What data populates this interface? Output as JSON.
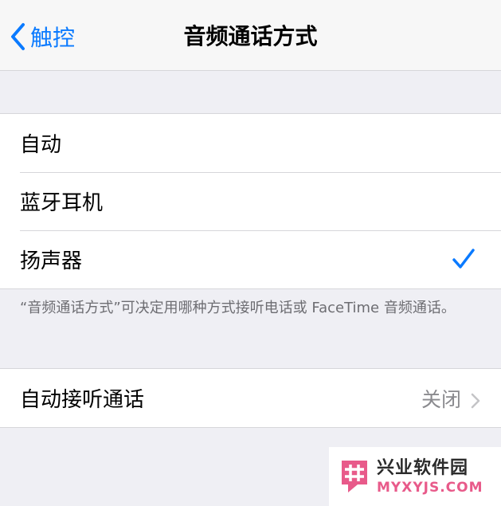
{
  "nav": {
    "back_label": "触控",
    "title": "音频通话方式"
  },
  "call_audio_routing": {
    "options": [
      {
        "label": "自动",
        "selected": false
      },
      {
        "label": "蓝牙耳机",
        "selected": false
      },
      {
        "label": "扬声器",
        "selected": true
      }
    ],
    "footer": "“音频通话方式”可决定用哪种方式接听电话或 FaceTime 音频通话。"
  },
  "auto_answer": {
    "label": "自动接听通话",
    "value": "关闭"
  },
  "watermark": {
    "title": "兴业软件园",
    "url": "MYXYJS.COM"
  },
  "colors": {
    "accent": "#0a7aff",
    "background": "#efeff4",
    "secondary_text": "#8a8a8e",
    "watermark_accent": "#e85a8a"
  },
  "icons": {
    "back": "chevron-left-icon",
    "selected": "checkmark-icon",
    "disclosure": "chevron-right-icon"
  }
}
